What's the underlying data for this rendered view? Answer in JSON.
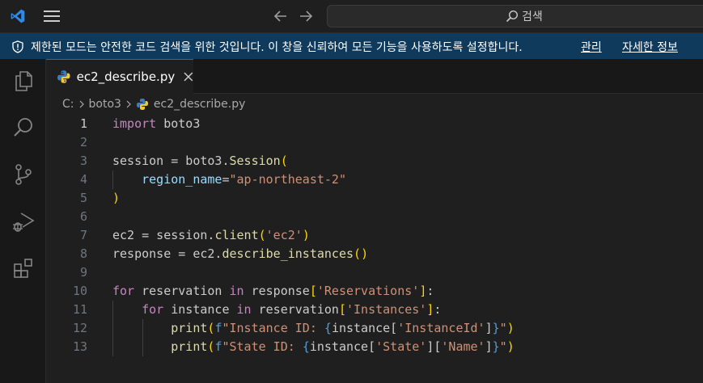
{
  "title_bar": {
    "search_label": "검색"
  },
  "banner": {
    "message": "제한된 모드는 안전한 코드 검색을 위한 것입니다. 이 창을 신뢰하여 모든 기능을 사용하도록 설정합니다.",
    "manage_link": "관리",
    "details_link": "자세한 정보"
  },
  "tab": {
    "label": "ec2_describe.py"
  },
  "breadcrumb": {
    "items": [
      "C:",
      "boto3",
      "ec2_describe.py"
    ]
  },
  "editor": {
    "active_line": 1,
    "lines": [
      {
        "n": "1",
        "text": "import boto3"
      },
      {
        "n": "2",
        "text": ""
      },
      {
        "n": "3",
        "text": "session = boto3.Session("
      },
      {
        "n": "4",
        "text": "    region_name=\"ap-northeast-2\""
      },
      {
        "n": "5",
        "text": ")"
      },
      {
        "n": "6",
        "text": ""
      },
      {
        "n": "7",
        "text": "ec2 = session.client('ec2')"
      },
      {
        "n": "8",
        "text": "response = ec2.describe_instances()"
      },
      {
        "n": "9",
        "text": ""
      },
      {
        "n": "10",
        "text": "for reservation in response['Reservations']:"
      },
      {
        "n": "11",
        "text": "    for instance in reservation['Instances']:"
      },
      {
        "n": "12",
        "text": "        print(f\"Instance ID: {instance['InstanceId']}\")"
      },
      {
        "n": "13",
        "text": "        print(f\"State ID: {instance['State']['Name']}\")"
      }
    ]
  },
  "icons": {
    "app": "vscode-logo-icon",
    "menu": "hamburger-menu-icon",
    "back": "arrow-left-icon",
    "forward": "arrow-right-icon",
    "search": "search-icon",
    "restricted": "shield-icon",
    "explorer": "files-icon",
    "activity_search": "search-icon",
    "source_control": "source-control-icon",
    "run_debug": "run-debug-icon",
    "extensions": "extensions-icon",
    "file": "python-icon",
    "close": "close-icon"
  },
  "colors": {
    "banner_bg": "#0f3a5c",
    "accent": "#0078d4",
    "keyword": "#c586c0",
    "string": "#ce9178",
    "function": "#dcdcaa",
    "parameter": "#9cdcfe"
  }
}
